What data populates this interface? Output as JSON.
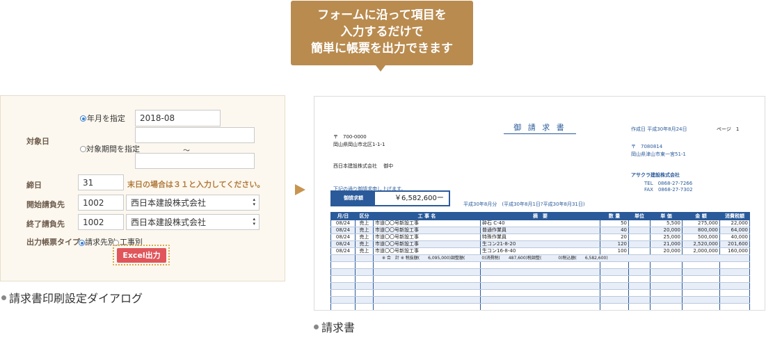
{
  "bubble": {
    "lines": [
      "フォームに沿って項目を",
      "入力するだけで",
      "簡単に帳票を出力できます"
    ]
  },
  "dialog": {
    "target_date_label": "対象日",
    "radio_month_label": "年月を指定",
    "month_value": "2018-08",
    "radio_period_label": "対象期間を指定",
    "period_separator": "〜",
    "period_from": "",
    "period_to": "",
    "closing_label": "締日",
    "closing_value": "31",
    "closing_note": "末日の場合は３１と入力してください。",
    "start_label": "開始請負先",
    "start_code": "1002",
    "start_name": "西日本建設株式会社",
    "end_label": "終了請負先",
    "end_code": "1002",
    "end_name": "西日本建設株式会社",
    "output_type_label": "出力帳票タイプ",
    "radio_invoice_label": "請求先別",
    "radio_work_label": "工事別",
    "excel_button": "Excel出力",
    "selected_date_mode": "month",
    "selected_output_type": "invoice"
  },
  "dialog_caption": "請求書印刷設定ダイアログ",
  "invoice_caption": "請求書",
  "invoice": {
    "title": "御 請 求 書",
    "issue_date": "作成日 平成30年8月24日",
    "page": "ページ　1",
    "to_zip": "〒　700-0000",
    "to_address": "岡山県岡山市北区1-1-1",
    "to_name": "西日本建設株式会社　 御中",
    "from_zip": "〒　7080814",
    "from_address": "岡山県津山市東一宮51-1",
    "from_company": "アサクラ建設株式会社",
    "from_tel": "TEL　0868-27-7266",
    "from_fax": "FAX　0868-27-7302",
    "greeting": "下記の通り御請求申し上げます。",
    "amount_label": "御請求額",
    "amount_value": "￥6,582,600ー",
    "period_text": "平成30年8月分　(平成30年8月1日?平成30年8月31日)",
    "columns": [
      "月/日",
      "区分",
      "工 事 名",
      "摘　要",
      "数 量",
      "単位",
      "単 価",
      "金 額",
      "消費税額"
    ],
    "rows": [
      [
        "08/24",
        "売上",
        "市道〇〇号新設工事",
        "砕石 C-40",
        "50",
        "",
        "5,500",
        "275,000",
        "22,000"
      ],
      [
        "08/24",
        "売上",
        "市道〇〇号新設工事",
        "普通作業員",
        "40",
        "",
        "20,000",
        "800,000",
        "64,000"
      ],
      [
        "08/24",
        "売上",
        "市道〇〇号新設工事",
        "特殊作業員",
        "20",
        "",
        "25,000",
        "500,000",
        "40,000"
      ],
      [
        "08/24",
        "売上",
        "市道〇〇号新設工事",
        "生コン21-8-20",
        "120",
        "",
        "21,000",
        "2,520,000",
        "201,600"
      ],
      [
        "08/24",
        "売上",
        "市道〇〇号新設工事",
        "生コン16-8-40",
        "100",
        "",
        "20,000",
        "2,000,000",
        "160,000"
      ]
    ],
    "summary": "※ 合　計 ※ 税抜額(　　6,095,000)調整額(　　　　0)消費税(　　487,600)税調整(　　　　0)税込額(　　6,582,600)"
  },
  "colors": {
    "bubble": "#b98b4f",
    "invoice_blue": "#2a5a9a",
    "excel_button": "#e0565b",
    "dialog_bg": "#fdf8ef"
  }
}
